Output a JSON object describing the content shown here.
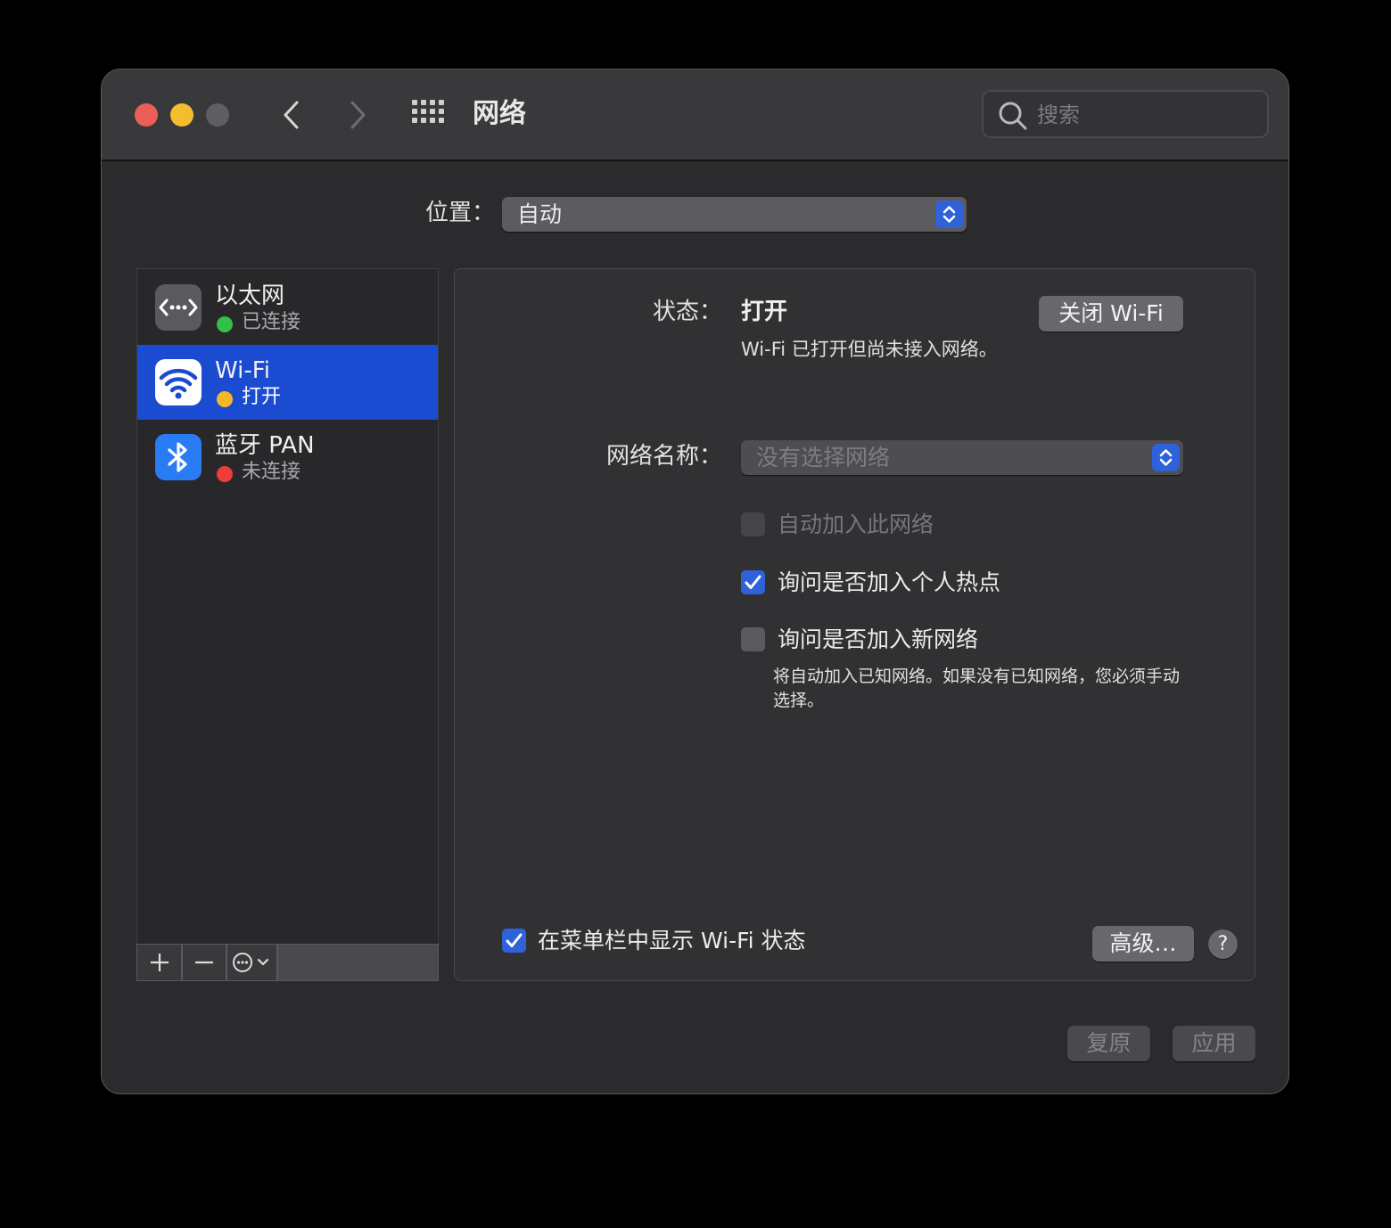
{
  "window": {
    "title": "网络",
    "search_placeholder": "搜索"
  },
  "location": {
    "label": "位置：",
    "value": "自动"
  },
  "services": [
    {
      "name": "以太网",
      "status": "已连接",
      "status_color": "#33c048",
      "icon": "ethernet-icon"
    },
    {
      "name": "Wi-Fi",
      "status": "打开",
      "status_color": "#f6b829",
      "icon": "wifi-icon"
    },
    {
      "name": "蓝牙 PAN",
      "status": "未连接",
      "status_color": "#ed3e3a",
      "icon": "bluetooth-icon"
    }
  ],
  "detail": {
    "status_label": "状态：",
    "status_value": "打开",
    "turn_off_button": "关闭 Wi-Fi",
    "status_description": "Wi-Fi 已打开但尚未接入网络。",
    "network_name_label": "网络名称：",
    "network_name_value": "没有选择网络",
    "auto_join_label": "自动加入此网络",
    "ask_hotspot_label": "询问是否加入个人热点",
    "ask_new_label": "询问是否加入新网络",
    "ask_new_note": "将自动加入已知网络。如果没有已知网络，您必须手动选择。",
    "show_menubar_label": "在菜单栏中显示 Wi-Fi 状态",
    "advanced_button": "高级…",
    "help_button": "?"
  },
  "footer": {
    "revert_button": "复原",
    "apply_button": "应用"
  },
  "colors": {
    "accent": "#2f62d8",
    "selection": "#1b4bd0"
  }
}
